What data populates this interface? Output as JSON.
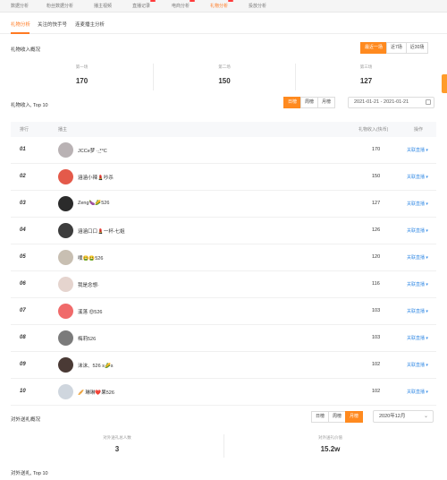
{
  "top_nav": [
    {
      "label": "数据分析",
      "active": false,
      "dot": false
    },
    {
      "label": "粉丝数据分析",
      "active": false,
      "dot": false
    },
    {
      "label": "播主视频",
      "active": false,
      "dot": false
    },
    {
      "label": "直播记录",
      "active": false,
      "dot": true
    },
    {
      "label": "电商分析",
      "active": false,
      "dot": true
    },
    {
      "label": "礼物分析",
      "active": true,
      "dot": true
    },
    {
      "label": "投放分析",
      "active": false,
      "dot": false
    }
  ],
  "sub_tabs": [
    "礼物分析",
    "关注的快手号",
    "连麦播主分析"
  ],
  "income_overview": {
    "title": "礼物收入概况",
    "ranges": [
      "最近一场",
      "近7场",
      "近30场"
    ],
    "cards": [
      {
        "label": "第一场",
        "value": "170"
      },
      {
        "label": "第二场",
        "value": "150"
      },
      {
        "label": "第三场",
        "value": "127"
      }
    ]
  },
  "top10": {
    "title": "礼物收入, Top 10",
    "periods": [
      "日榜",
      "周榜",
      "月榜"
    ],
    "date_range": "2021-01-21 - 2021-01-21",
    "headers": {
      "rank": "排行",
      "user": "播主",
      "income": "礼物收入(快币)",
      "action": "操作"
    },
    "action_label": "关联直播 ▾",
    "rows": [
      {
        "rank": "01",
        "name": "JCCe梦 ·͜·*°C",
        "amount": "170",
        "avatar": "#b9b2b4"
      },
      {
        "rank": "02",
        "name": "涵涵小辣💄吵杀",
        "amount": "150",
        "avatar": "#e45a4a"
      },
      {
        "rank": "03",
        "name": "Zeng🍆🌽526",
        "amount": "127",
        "avatar": "#2b2b2b"
      },
      {
        "rank": "04",
        "name": "涵涵口口💄一杯-七姐",
        "amount": "126",
        "avatar": "#3d3d3d"
      },
      {
        "rank": "05",
        "name": "噗🤮🤮526",
        "amount": "120",
        "avatar": "#c8bfb2"
      },
      {
        "rank": "06",
        "name": "我是念想·",
        "amount": "116",
        "avatar": "#e5d4ce"
      },
      {
        "rank": "07",
        "name": "溪落 😍526",
        "amount": "103",
        "avatar": "#f06a6a"
      },
      {
        "rank": "08",
        "name": "梅莉526",
        "amount": "103",
        "avatar": "#7b7b7b"
      },
      {
        "rank": "09",
        "name": "沫沫、526 s🌽s",
        "amount": "102",
        "avatar": "#4a3a35"
      },
      {
        "rank": "10",
        "name": "🥖 琳琳❤️果526",
        "amount": "102",
        "avatar": "#cfd6de"
      }
    ]
  },
  "outgoing_overview": {
    "title": "对外送礼概况",
    "periods": [
      "日榜",
      "周榜",
      "月榜"
    ],
    "month": "2020年12月",
    "cards": [
      {
        "label": "对外送礼总人数",
        "value": "3"
      },
      {
        "label": "对外送礼价值",
        "value": "15.2w"
      }
    ]
  },
  "outgoing_top10_title": "对外送礼, Top 10",
  "colors": {
    "accent": "#ff8a1f",
    "link": "#3a8ee6"
  }
}
